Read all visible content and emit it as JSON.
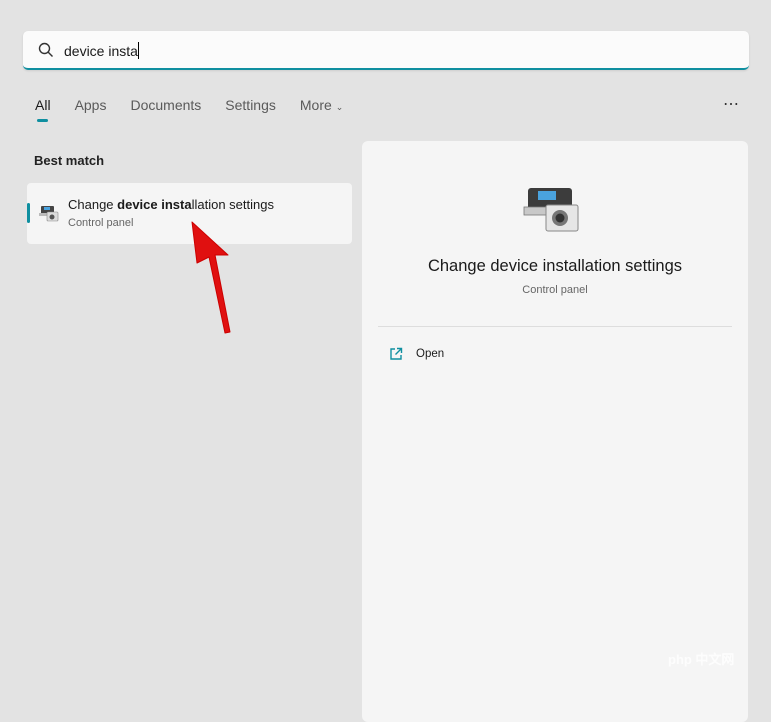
{
  "search": {
    "value": "device insta",
    "icon": "search-icon"
  },
  "tabs": [
    {
      "label": "All",
      "active": true
    },
    {
      "label": "Apps"
    },
    {
      "label": "Documents"
    },
    {
      "label": "Settings"
    },
    {
      "label": "More"
    }
  ],
  "more_menu": "⋯",
  "best_match": {
    "heading": "Best match",
    "title_pre": "Change ",
    "title_bold": "device insta",
    "title_post": "llation settings",
    "subtitle": "Control panel"
  },
  "detail": {
    "title": "Change device installation settings",
    "subtitle": "Control panel",
    "actions": [
      {
        "label": "Open",
        "icon": "open-external-icon"
      }
    ]
  },
  "colors": {
    "accent": "#0f8fa0",
    "annotation_arrow": "#e01010"
  },
  "watermark": "php 中文网"
}
